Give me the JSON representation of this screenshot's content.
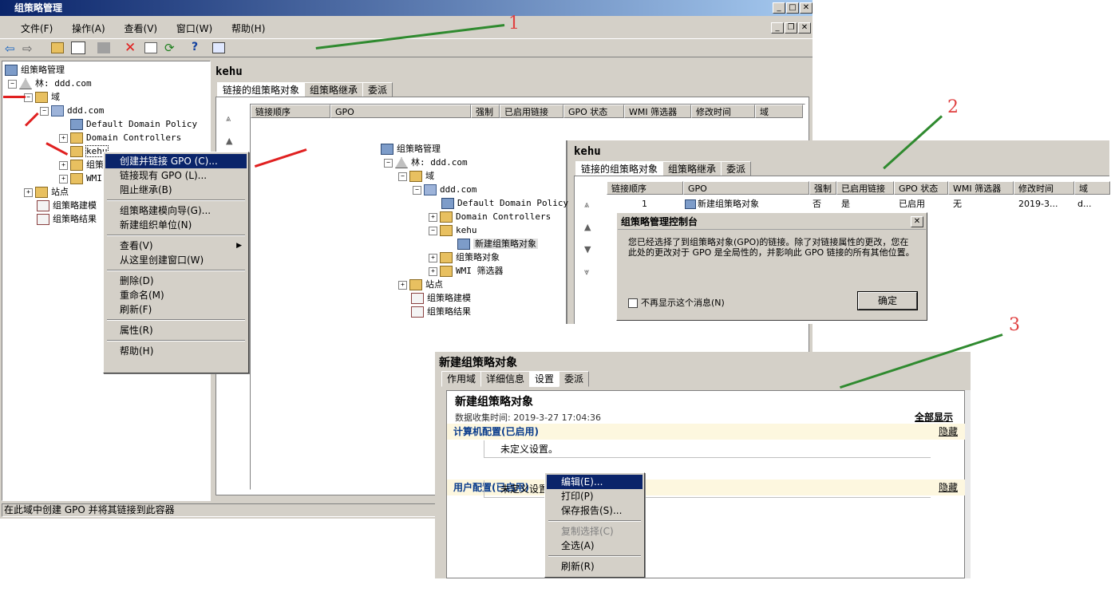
{
  "main_window": {
    "title": "组策略管理",
    "menu": [
      "文件(F)",
      "操作(A)",
      "查看(V)",
      "窗口(W)",
      "帮助(H)"
    ],
    "status": "在此域中创建 GPO 并将其链接到此容器",
    "tree": {
      "root": "组策略管理",
      "forest": "林: ddd.com",
      "domains": "域",
      "domain": "ddd.com",
      "items": [
        "Default Domain Policy",
        "Domain Controllers",
        "kehu",
        "组策略对象",
        "WMI 筛选器"
      ],
      "sites": "站点",
      "modeling": "组策略建模",
      "results": "组策略结果"
    },
    "right_title": "kehu",
    "tabs": [
      "链接的组策略对象",
      "组策略继承",
      "委派"
    ],
    "columns": [
      "链接顺序",
      "GPO",
      "强制",
      "已启用链接",
      "GPO 状态",
      "WMI 筛选器",
      "修改时间",
      "域"
    ]
  },
  "context_menu": {
    "items": [
      "创建并链接 GPO (C)...",
      "链接现有 GPO (L)...",
      "阻止继承(B)",
      "组策略建模向导(G)...",
      "新建组织单位(N)",
      "查看(V)",
      "从这里创建窗口(W)",
      "删除(D)",
      "重命名(M)",
      "刷新(F)",
      "属性(R)",
      "帮助(H)"
    ]
  },
  "panel2": {
    "new_gpo": "新建组策略对象",
    "row": {
      "order": "1",
      "gpo": "新建组策略对象",
      "enforced": "否",
      "enabled": "是",
      "status": "已启用",
      "wmi": "无",
      "modified": "2019-3...",
      "domain": "d..."
    },
    "dialog": {
      "title": "组策略管理控制台",
      "message": "您已经选择了到组策略对象(GPO)的链接。除了对链接属性的更改，您在此处的更改对于 GPO 是全局性的，并影响此 GPO 链接的所有其他位置。",
      "checkbox": "不再显示这个消息(N)",
      "ok": "确定"
    }
  },
  "panel3": {
    "title": "新建组策略对象",
    "tabs": [
      "作用域",
      "详细信息",
      "设置",
      "委派"
    ],
    "report_title": "新建组策略对象",
    "collected": "数据收集时间: 2019-3-27 17:04:36",
    "show_all": "全部显示",
    "computer": "计算机配置(已启用)",
    "user": "用户配置(已启用)",
    "hide": "隐藏",
    "undefined": "未定义设置。",
    "undefined_cut": "未定义设置",
    "menu": [
      "编辑(E)...",
      "打印(P)",
      "保存报告(S)...",
      "复制选择(C)",
      "全选(A)",
      "刷新(R)"
    ]
  },
  "annotations": [
    "1",
    "2",
    "3"
  ],
  "colors": {
    "accent_arrow": "#2f8a2f",
    "red_arrow": "#e02020",
    "selection": "#0a246a"
  }
}
